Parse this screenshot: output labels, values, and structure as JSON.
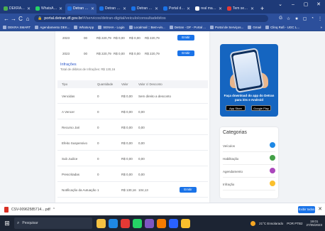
{
  "tabs": [
    {
      "label": "DEKRA SMAR",
      "color": "#4caf50"
    },
    {
      "label": "WhatsApp",
      "color": "#25d366"
    },
    {
      "label": "Detran Digit",
      "color": "#1a73e8"
    },
    {
      "label": "Detran Digit",
      "color": "#1a73e8"
    },
    {
      "label": "Detran Digit",
      "color": "#1a73e8"
    },
    {
      "label": "Portal de Se",
      "color": "#1a73e8"
    },
    {
      "label": "real madrid",
      "color": "#ffffff"
    },
    {
      "label": "Tem sempre",
      "color": "#e53935"
    }
  ],
  "active_tab_index": 2,
  "new_tab_symbol": "+",
  "window_controls": [
    "⌄",
    "–",
    "▢",
    "✕"
  ],
  "address": {
    "domain": "portal.detran.df.gov.br",
    "path": "/#/servicos/detran-digital/veiculo/consultadebitos"
  },
  "nav": {
    "back": "←",
    "forward": "→",
    "reload": "C",
    "home": "⌂"
  },
  "toolbar_icons": [
    "G",
    "☆",
    "★",
    "▢",
    "◔",
    "⋮"
  ],
  "bookmarks": [
    {
      "label": "DEKRA SMART"
    },
    {
      "label": "Agendamento DEK..."
    },
    {
      "label": "WhatsApp"
    },
    {
      "label": "SENHA - Login"
    },
    {
      "label": "Localmail :: Bem-vin..."
    },
    {
      "label": "Detran - DF - Portal ..."
    },
    {
      "label": "Portal de Serviços..."
    },
    {
      "label": "Gmail"
    },
    {
      "label": "Clinq Rafi - UGC L..."
    }
  ],
  "bookmarks_more": "»",
  "top_rows": [
    {
      "year": "2023",
      "code": "00",
      "value": "R$ 220,79",
      "juros": "R$ 0,00",
      "multa": "R$ 0,00",
      "total": "R$ 220,79",
      "action": "Emitir"
    },
    {
      "year": "2023",
      "code": "00",
      "value": "R$ 220,79",
      "juros": "R$ 0,00",
      "multa": "R$ 0,00",
      "total": "R$ 220,79",
      "action": "Emitir"
    }
  ],
  "infractions": {
    "title": "Infrações",
    "subtitle": "Total de débitos de Infrações: R$ 130,16",
    "headers": {
      "tipo": "Tipo",
      "quantidade": "Quantidade",
      "valor": "Valor",
      "valor_desconto": "Valor c/ Desconto"
    },
    "rows": [
      {
        "tipo": "Vencidas",
        "quantidade": "0",
        "valor": "R$ 0,00",
        "desconto": "Sem direito a desconto",
        "action": ""
      },
      {
        "tipo": "A Vencer",
        "quantidade": "0",
        "valor": "R$ 0,00",
        "desconto": "0,00",
        "action": ""
      },
      {
        "tipo": "Recurso Jari",
        "quantidade": "0",
        "valor": "R$ 0,00",
        "desconto": "0,00",
        "action": ""
      },
      {
        "tipo": "Efeito Suspensivo",
        "quantidade": "0",
        "valor": "R$ 0,00",
        "desconto": "0,00",
        "action": ""
      },
      {
        "tipo": "Sub Judice",
        "quantidade": "0",
        "valor": "R$ 0,00",
        "desconto": "0,00",
        "action": ""
      },
      {
        "tipo": "Prescritadas",
        "quantidade": "0",
        "valor": "R$ 0,00",
        "desconto": "0,00",
        "action": ""
      },
      {
        "tipo": "Notificação da Autuação",
        "quantidade": "1",
        "valor": "R$ 130,16",
        "desconto": "104,13",
        "action": "Emitir"
      }
    ]
  },
  "promo": {
    "text": "Faça download do app do Detran para iOs e Android",
    "app_store": "App Store",
    "google_play": "Google Play"
  },
  "categories": {
    "title": "Categorias",
    "items": [
      {
        "label": "Veículos",
        "color": "#1e88e5"
      },
      {
        "label": "Habilitação",
        "color": "#43a047"
      },
      {
        "label": "Agendamento",
        "color": "#ab47bc"
      },
      {
        "label": "Infração",
        "color": "#fbc02d"
      }
    ]
  },
  "download": {
    "filename": "CSV-00962585714....pdf",
    "caret": "^",
    "show_all": "Exibir todos",
    "close": "✕"
  },
  "taskbar": {
    "search_placeholder": "Pesquisar",
    "weather": "21°C Ensolarado",
    "lang": "POR PTB2",
    "time": "19:01",
    "date": "27/05/2023",
    "apps": [
      "#f5c242",
      "#1e88e5",
      "#e53935",
      "#25d366",
      "#7e57c2",
      "#f57c00",
      "#2962ff",
      "#fbc02d"
    ]
  }
}
